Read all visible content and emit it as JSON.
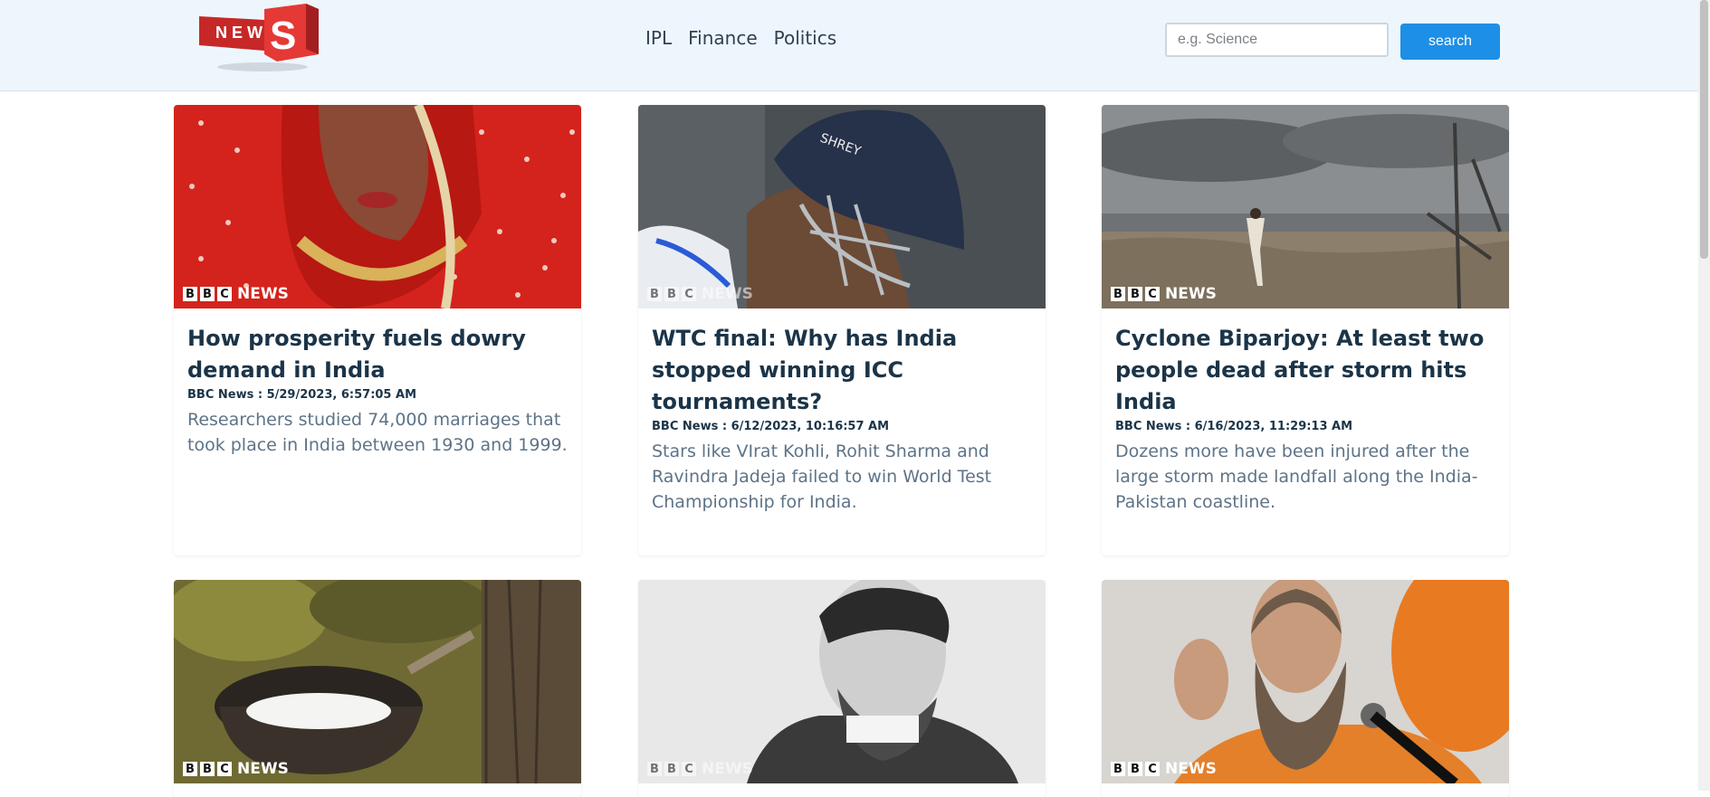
{
  "header": {
    "logo_text": "NEWS",
    "nav": [
      "IPL",
      "Finance",
      "Politics"
    ],
    "search_placeholder": "e.g. Science",
    "search_button": "search"
  },
  "colors": {
    "accent": "#1d8fe6",
    "header_bg": "#eef6fd",
    "title": "#1b3448",
    "description": "#5e7387",
    "logo_red": "#d32f2f"
  },
  "cards": [
    {
      "image": "bride-red-saree-photo",
      "source_mark": "NEWS",
      "title": "How prosperity fuels dowry demand in India",
      "meta": "BBC News : 5/29/2023, 6:57:05 AM",
      "description": "Researchers studied 74,000 marriages that took place in India between 1930 and 1999."
    },
    {
      "image": "cricketer-helmet-photo",
      "source_mark": "NEWS",
      "title": "WTC final: Why has India stopped winning ICC tournaments?",
      "meta": "BBC News : 6/12/2023, 10:16:57 AM",
      "description": "Stars like VIrat Kohli, Rohit Sharma and Ravindra Jadeja failed to win World Test Championship for India."
    },
    {
      "image": "stormy-coast-photo",
      "source_mark": "NEWS",
      "title": "Cyclone Biparjoy: At least two people dead after storm hits India",
      "meta": "BBC News : 6/16/2023, 11:29:13 AM",
      "description": "Dozens more have been injured after the large storm made landfall along the India-Pakistan coastline."
    },
    {
      "image": "rubber-tapping-bowl-photo",
      "source_mark": "NEWS"
    },
    {
      "image": "bearded-man-portrait-photo",
      "source_mark": "NEWS"
    },
    {
      "image": "bearded-man-microphone-photo",
      "source_mark": "NEWS"
    }
  ]
}
